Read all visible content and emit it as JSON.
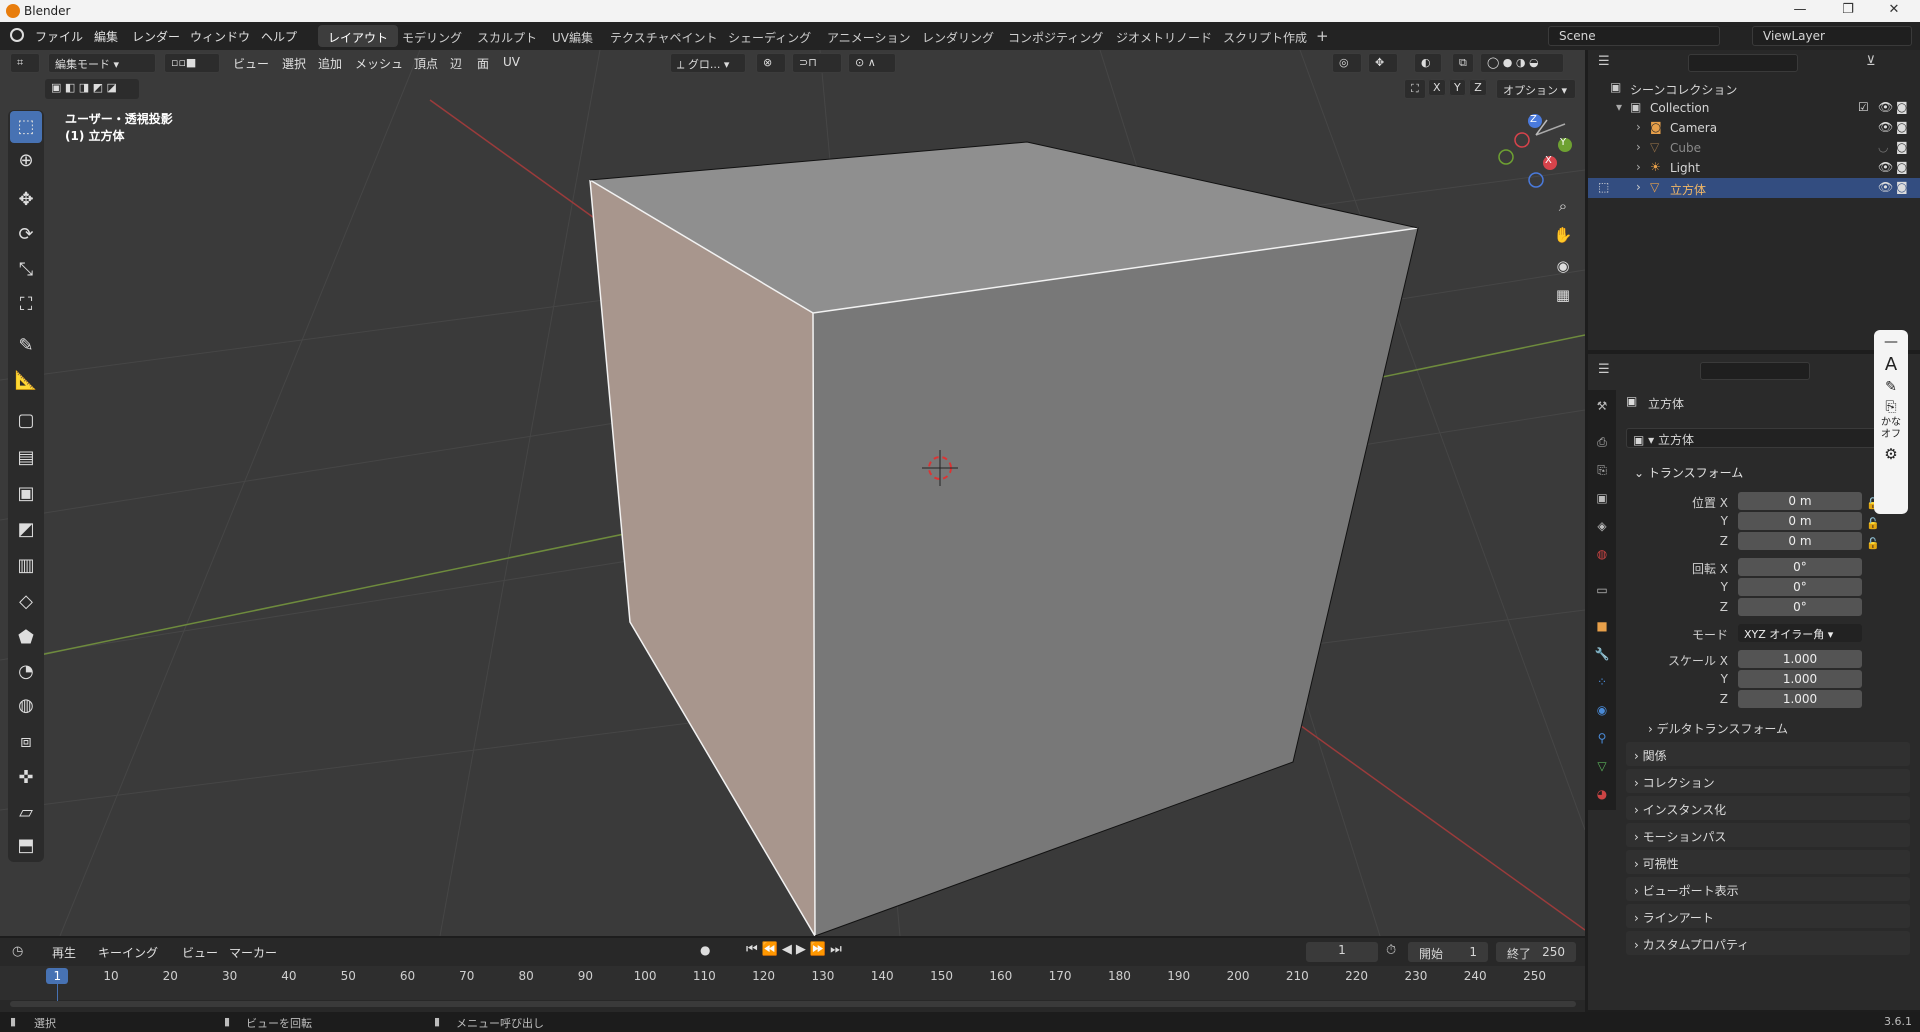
{
  "window": {
    "title": "Blender",
    "controls": [
      "—",
      "❐",
      "✕"
    ]
  },
  "menu": [
    "ファイル",
    "編集",
    "レンダー",
    "ウィンドウ",
    "ヘルプ"
  ],
  "workspaces": [
    "レイアウト",
    "モデリング",
    "スカルプト",
    "UV編集",
    "テクスチャペイント",
    "シェーディング",
    "アニメーション",
    "レンダリング",
    "コンポジティング",
    "ジオメトリノード",
    "スクリプト作成"
  ],
  "scene": {
    "name": "Scene",
    "view_layer": "ViewLayer"
  },
  "viewport": {
    "mode": "編集モード",
    "menus": [
      "ビュー",
      "選択",
      "追加",
      "メッシュ",
      "頂点",
      "辺",
      "面",
      "UV"
    ],
    "transform_orientation": "グロ...",
    "overlay_title": "ユーザー・透視投影",
    "overlay_object": "(1) 立方体",
    "axis_labels": [
      "X",
      "Y",
      "Z"
    ],
    "options_label": "オプション",
    "gizmo": {
      "x": "X",
      "y": "Y",
      "z": "Z"
    }
  },
  "outliner": {
    "root": "シーンコレクション",
    "collection": "Collection",
    "items": [
      {
        "name": "Camera",
        "selected": false
      },
      {
        "name": "Cube",
        "selected": false
      },
      {
        "name": "Light",
        "selected": false
      },
      {
        "name": "立方体",
        "selected": true
      }
    ]
  },
  "properties": {
    "object_name": "立方体",
    "data_name": "立方体",
    "transform_header": "トランスフォーム",
    "location": {
      "label": "位置 X",
      "x": "0 m",
      "y": "0 m",
      "z": "0 m"
    },
    "rotation": {
      "label": "回転 X",
      "x": "0°",
      "y": "0°",
      "z": "0°"
    },
    "mode": {
      "label": "モード",
      "value": "XYZ オイラー角"
    },
    "scale": {
      "label": "スケール X",
      "x": "1.000",
      "y": "1.000",
      "z": "1.000"
    },
    "axis_y": "Y",
    "axis_z": "Z",
    "delta": "デルタトランスフォーム",
    "sections": [
      "関係",
      "コレクション",
      "インスタンス化",
      "モーションパス",
      "可視性",
      "ビューポート表示",
      "ラインアート",
      "カスタムプロパティ"
    ]
  },
  "ime": {
    "label": "かな\nオフ"
  },
  "timeline": {
    "menus": [
      "再生",
      "キーイング",
      "ビュー",
      "マーカー"
    ],
    "current_frame": "1",
    "start_label": "開始",
    "start": "1",
    "end_label": "終了",
    "end": "250",
    "ticks": [
      "1",
      "10",
      "20",
      "30",
      "40",
      "50",
      "60",
      "70",
      "80",
      "90",
      "100",
      "110",
      "120",
      "130",
      "140",
      "150",
      "160",
      "170",
      "180",
      "190",
      "200",
      "210",
      "220",
      "230",
      "240",
      "250"
    ]
  },
  "statusbar": {
    "select": "選択",
    "rotate": "ビューを回転",
    "menu": "メニュー呼び出し",
    "version": "3.6.1"
  },
  "colors": {
    "accent": "#4772b3",
    "selected_row": "#334d80",
    "object_orange": "#e8a04a"
  }
}
